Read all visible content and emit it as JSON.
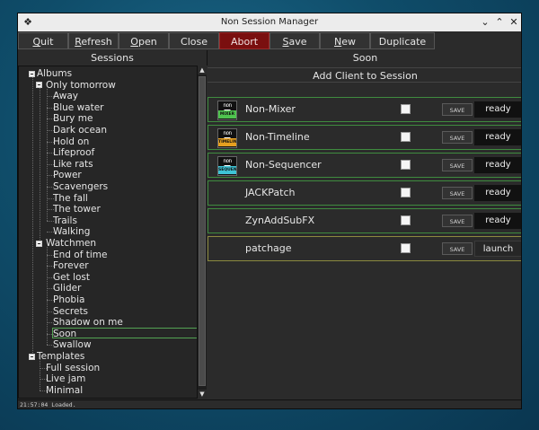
{
  "window": {
    "title": "Non Session Manager"
  },
  "toolbar": {
    "quit": {
      "underline": "Q",
      "rest": "uit"
    },
    "refresh": {
      "underline": "R",
      "rest": "efresh"
    },
    "open": {
      "underline": "O",
      "rest": "pen"
    },
    "close": "Close",
    "abort": "Abort",
    "save": {
      "underline": "S",
      "rest": "ave"
    },
    "new": {
      "underline": "N",
      "rest": "ew"
    },
    "duplicate": "Duplicate"
  },
  "sessions_header": "Sessions",
  "current_session": "Soon",
  "tree": [
    {
      "label": "Albums",
      "level": 0,
      "expander": true
    },
    {
      "label": "Only tomorrow",
      "level": 1,
      "expander": true
    },
    {
      "label": "Away",
      "level": 2
    },
    {
      "label": "Blue water",
      "level": 2
    },
    {
      "label": "Bury me",
      "level": 2
    },
    {
      "label": "Dark ocean",
      "level": 2
    },
    {
      "label": "Hold on",
      "level": 2
    },
    {
      "label": "Lifeproof",
      "level": 2
    },
    {
      "label": "Like rats",
      "level": 2
    },
    {
      "label": "Power",
      "level": 2
    },
    {
      "label": "Scavengers",
      "level": 2
    },
    {
      "label": "The fall",
      "level": 2
    },
    {
      "label": "The tower",
      "level": 2
    },
    {
      "label": "Trails",
      "level": 2
    },
    {
      "label": "Walking",
      "level": 2
    },
    {
      "label": "Watchmen",
      "level": 1,
      "expander": true
    },
    {
      "label": "End of time",
      "level": 2
    },
    {
      "label": "Forever",
      "level": 2
    },
    {
      "label": "Get lost",
      "level": 2
    },
    {
      "label": "Glider",
      "level": 2
    },
    {
      "label": "Phobia",
      "level": 2
    },
    {
      "label": "Secrets",
      "level": 2
    },
    {
      "label": "Shadow on me",
      "level": 2
    },
    {
      "label": "Soon",
      "level": 2,
      "selected": true
    },
    {
      "label": "Swallow",
      "level": 2
    },
    {
      "label": "Templates",
      "level": 0,
      "expander": true
    },
    {
      "label": "Full session",
      "level": 1
    },
    {
      "label": "Live jam",
      "level": 1
    },
    {
      "label": "Minimal",
      "level": 1
    }
  ],
  "add_client_label": "Add Client to Session",
  "clients": [
    {
      "name": "Non-Mixer",
      "icon": "non-mixer-icon",
      "icon_band": "MIXER",
      "icon_color": "#4fc34f",
      "save_label": "SAVE",
      "status": "ready",
      "border": "#3f8c3f"
    },
    {
      "name": "Non-Timeline",
      "icon": "non-timeline-icon",
      "icon_band": "TIMELINE",
      "icon_color": "#e6a020",
      "save_label": "SAVE",
      "status": "ready",
      "border": "#3f8c3f"
    },
    {
      "name": "Non-Sequencer",
      "icon": "non-sequencer-icon",
      "icon_band": "SEQUENCER",
      "icon_color": "#3ec4d6",
      "save_label": "SAVE",
      "status": "ready",
      "border": "#3f8c3f"
    },
    {
      "name": "JACKPatch",
      "icon": "",
      "save_label": "SAVE",
      "status": "ready",
      "border": "#3f8c3f"
    },
    {
      "name": "ZynAddSubFX",
      "icon": "",
      "save_label": "SAVE",
      "status": "ready",
      "border": "#3f8c3f"
    },
    {
      "name": "patchage",
      "icon": "",
      "save_label": "SAVE",
      "status": "launch",
      "border": "#8c8a3f"
    }
  ],
  "icon_logo_text": "non",
  "status_bar": "21:57:04 Loaded."
}
